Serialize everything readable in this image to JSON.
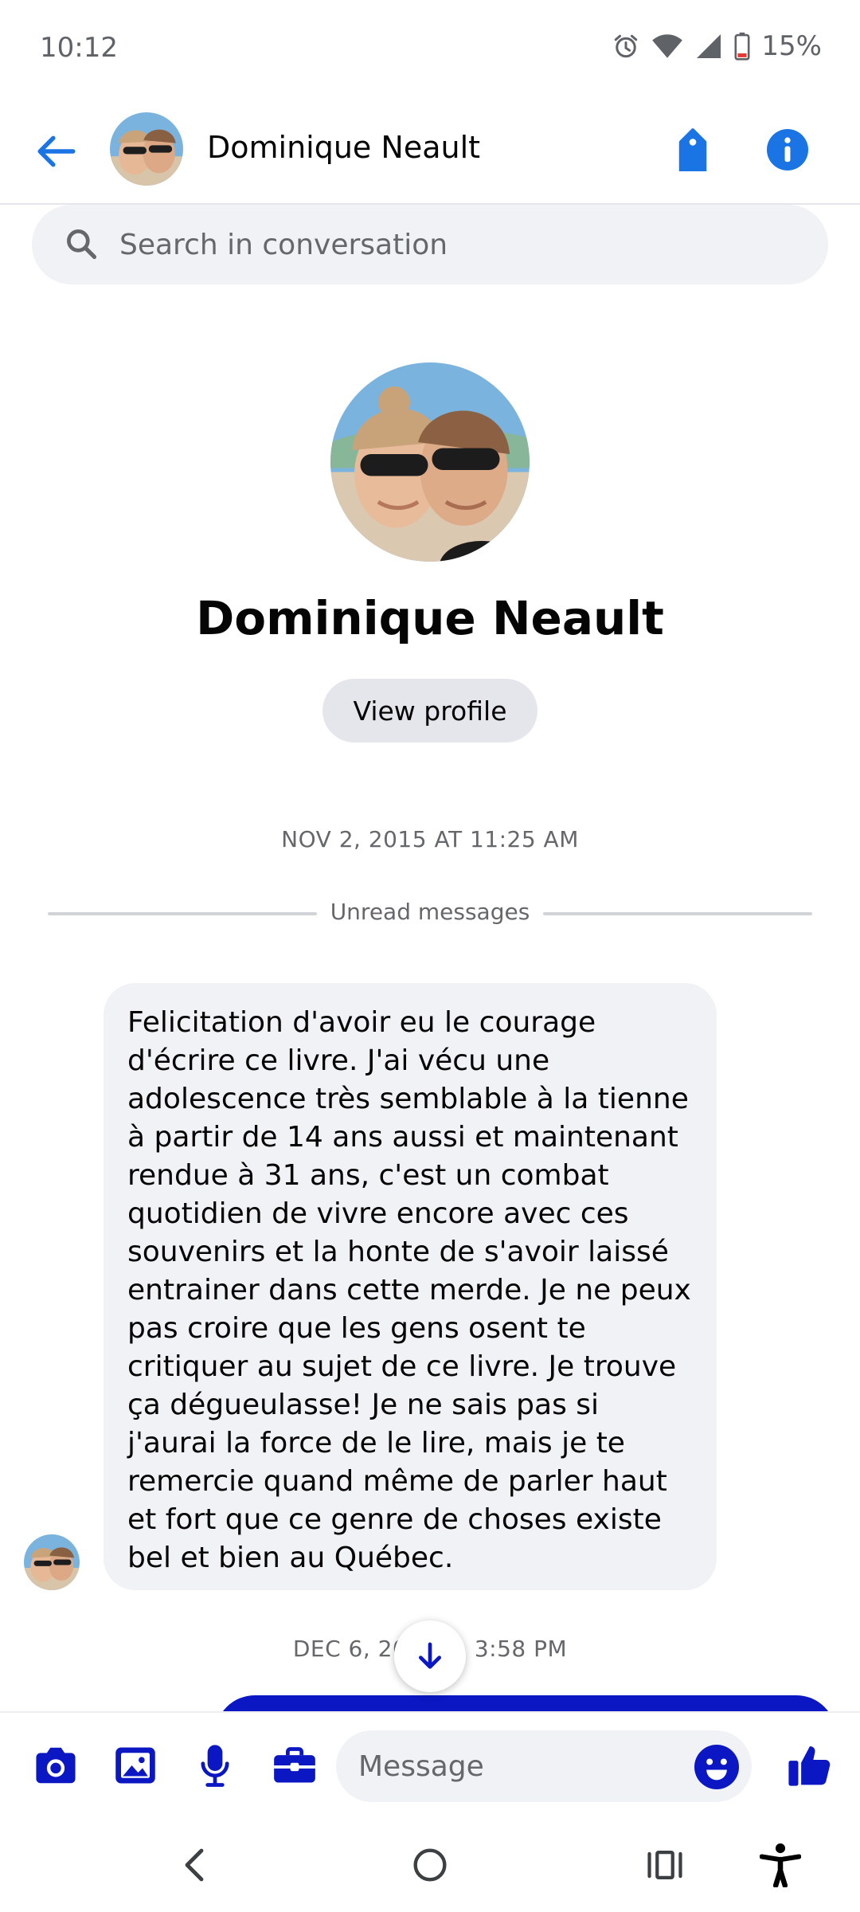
{
  "status_bar": {
    "time": "10:12",
    "battery_percent": "15%",
    "icons": [
      "alarm-icon",
      "wifi-icon",
      "signal-icon",
      "battery-low-icon"
    ]
  },
  "header": {
    "contact_name": "Dominique Neault",
    "icons": [
      "back-arrow-icon",
      "tag-icon",
      "info-icon"
    ],
    "accent_color": "#1b74e4"
  },
  "search": {
    "placeholder": "Search in conversation"
  },
  "profile": {
    "name": "Dominique Neault",
    "view_profile_label": "View profile"
  },
  "conversation": {
    "timestamp_1": "NOV 2, 2015 AT 11:25 AM",
    "unread_label": "Unread messages",
    "received_message": "Felicitation d'avoir eu le courage d'écrire ce livre. J'ai vécu une adolescence très semblable à la tienne à partir de 14 ans aussi et maintenant rendue à 31 ans, c'est un combat quotidien de vivre encore avec ces souvenirs et la honte de s'avoir laissé entrainer dans cette merde. Je ne peux pas croire que les gens osent te critiquer au sujet de ce livre. Je trouve ça dégueulasse! Je ne sais pas si j'aurai la force de le lire, mais je te remercie quand même de parler haut et fort que ce genre de choses existe bel et bien au Québec.",
    "timestamp_2": "DEC 6, 20         3:58 PM",
    "sent_bubble_color": "#0a17c2"
  },
  "composer": {
    "placeholder": "Message",
    "icons": [
      "camera-icon",
      "gallery-icon",
      "microphone-icon",
      "briefcase-icon",
      "emoji-icon",
      "thumbs-up-icon"
    ],
    "accent_color": "#0a17c2"
  },
  "nav_bar": {
    "icons": [
      "nav-back-icon",
      "nav-home-icon",
      "nav-recents-icon",
      "accessibility-icon"
    ]
  }
}
